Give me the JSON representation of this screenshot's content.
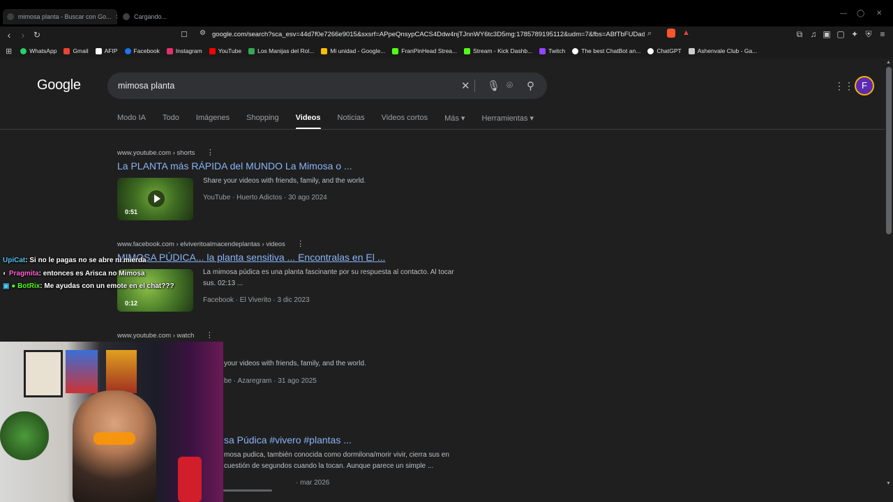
{
  "tabs": [
    {
      "title": "mimosa planta - Buscar con Go..."
    },
    {
      "title": "Cargando..."
    }
  ],
  "toolbar": {
    "url": "google.com/search?sca_esv=44d7f0e7266e9015&sxsrf=APpeQnsypCACS4Ddw4njTJnnWY6tc3D5mg:1785789195112&udm=7&fbs=ABfTbFUDadge..."
  },
  "bookmarks": [
    {
      "label": "WhatsApp",
      "color": "#25d366"
    },
    {
      "label": "Gmail",
      "color": "#ea4335"
    },
    {
      "label": "AFIP",
      "color": "#ffffff"
    },
    {
      "label": "Facebook",
      "color": "#1877f2"
    },
    {
      "label": "Instagram",
      "color": "#e1306c"
    },
    {
      "label": "YouTube",
      "color": "#ff0000"
    },
    {
      "label": "Los Manijas del Rol...",
      "color": "#34a853"
    },
    {
      "label": "Mi unidad - Google...",
      "color": "#fbbc04"
    },
    {
      "label": "FranPinHead Strea...",
      "color": "#53fc18"
    },
    {
      "label": "Stream - Kick Dashb...",
      "color": "#53fc18"
    },
    {
      "label": "Twitch",
      "color": "#9146ff"
    },
    {
      "label": "The best ChatBot an...",
      "color": "#ffffff"
    },
    {
      "label": "ChatGPT",
      "color": "#ffffff"
    },
    {
      "label": "Ashenvale Club - Ga...",
      "color": "#cccccc"
    }
  ],
  "google": {
    "logo": "Google",
    "query": "mimosa planta",
    "avatar_letter": "F",
    "nav_tabs": [
      "Modo IA",
      "Todo",
      "Imágenes",
      "Shopping",
      "Videos",
      "Noticias",
      "Videos cortos",
      "Más ▾",
      "Herramientas ▾"
    ],
    "active_tab": "Videos"
  },
  "results": [
    {
      "site": "www.youtube.com › shorts",
      "title": "La PLANTA más RÁPIDA del MUNDO La Mimosa o ...",
      "snippet": "Share your videos with friends, family, and the world.",
      "meta": "YouTube · Huerto Adictos · 30 ago 2024",
      "duration": "0:51"
    },
    {
      "site": "www.facebook.com › elviveritoalmacendeplantas › videos",
      "title": "MIMOSA PÚDICA... la planta sensitiva ... Encontralas en El ...",
      "snippet": "La mimosa púdica es una planta fascinante por su respuesta al contacto. Al tocar sus. 02:13 ...",
      "meta": "Facebook · El Viverito · 3 dic 2023",
      "duration": "0:12"
    },
    {
      "site": "www.youtube.com › watch",
      "title": "",
      "snippet": "your videos with friends, family, and the world.",
      "meta": "be · Azaregram · 31 ago 2025",
      "duration": ""
    },
    {
      "site": "",
      "title": "sa Púdica #vivero #plantas ...",
      "snippet": "mosa pudica, también conocida como dormilona/morir vivir, cierra sus en cuestión de segundos cuando la tocan. Aunque parece un simple ...",
      "meta": "· mar 2026",
      "duration": ""
    }
  ],
  "chat": [
    {
      "user": "UpiCat",
      "message": ": Si no le pagas no se abre ni mierda",
      "color": "#4fc3f7"
    },
    {
      "user": "Pragmita",
      "message": ": entonces es Arisca no Mimosa",
      "color": "#ff5fd2"
    },
    {
      "user": "BotRix",
      "message": ": Me ayudas con un emote en el chat???",
      "color": "#53fc18"
    }
  ]
}
